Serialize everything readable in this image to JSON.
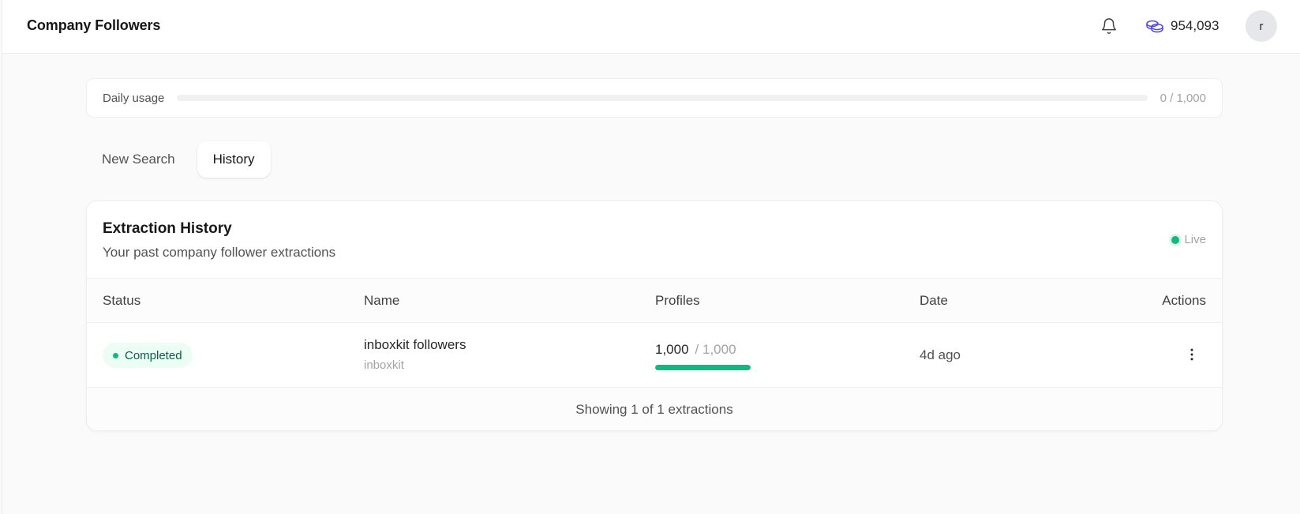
{
  "header": {
    "title": "Company Followers",
    "credits": "954,093",
    "avatar_initial": "r"
  },
  "usage": {
    "label": "Daily usage",
    "value": "0 / 1,000",
    "used": 0,
    "limit": 1000
  },
  "tabs": [
    {
      "label": "New Search",
      "active": false
    },
    {
      "label": "History",
      "active": true
    }
  ],
  "history": {
    "title": "Extraction History",
    "subtitle": "Your past company follower extractions",
    "live_label": "Live",
    "columns": [
      "Status",
      "Name",
      "Profiles",
      "Date",
      "Actions"
    ],
    "rows": [
      {
        "status": "Completed",
        "name": "inboxkit followers",
        "company": "inboxkit",
        "profiles": "1,000",
        "profiles_total": "/ 1,000",
        "progress": 1.0,
        "date": "4d ago"
      }
    ],
    "footer": "Showing 1 of 1 extractions"
  },
  "colors": {
    "accent": "#10b981",
    "badge_bg": "#ecfdf5",
    "badge_text": "#065f46",
    "credit_icon": "#4f46e5"
  },
  "icons": {
    "notifications": "bell-icon",
    "credits": "coins-icon",
    "row_actions": "more-vertical-icon"
  }
}
